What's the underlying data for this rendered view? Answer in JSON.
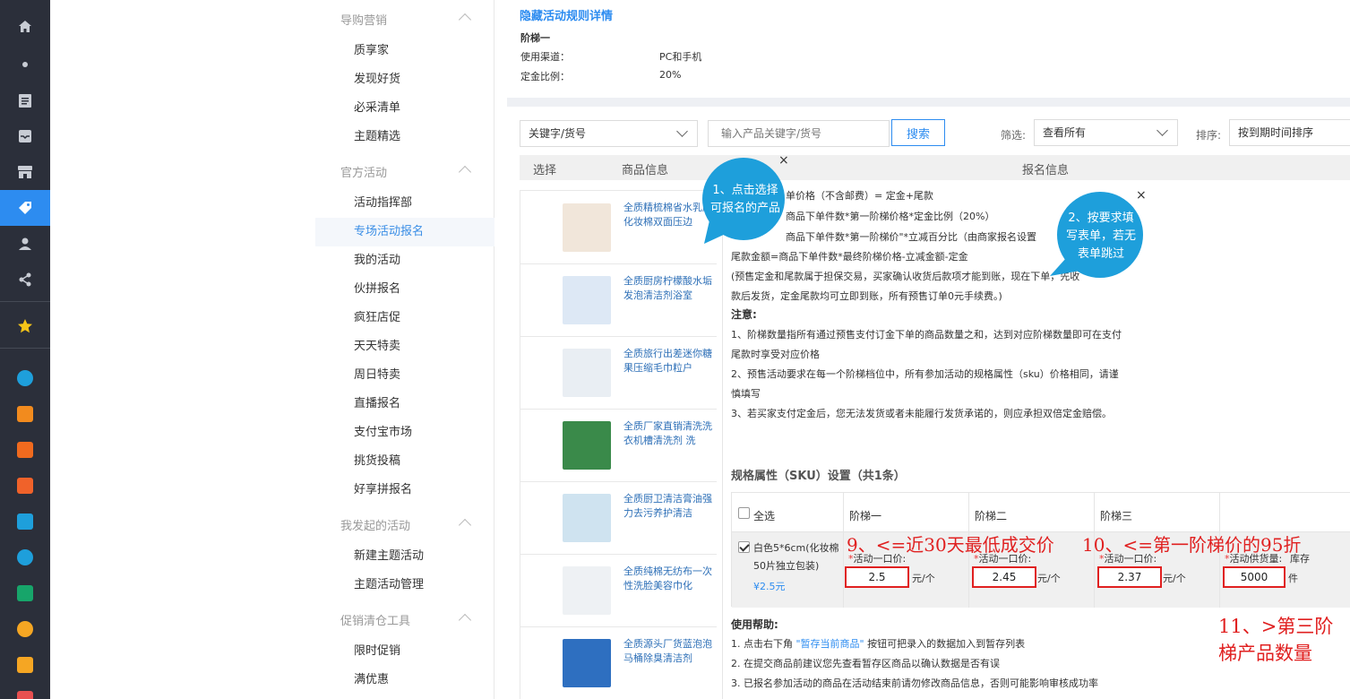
{
  "rail": {
    "icons": [
      "home-icon",
      "dot-icon",
      "clipboard-icon",
      "inbox-icon",
      "store-icon",
      "tag-icon",
      "user-icon",
      "share-icon",
      "star-icon",
      "app-icon-1",
      "app-icon-2",
      "app-icon-3",
      "app-icon-4",
      "app-icon-5",
      "app-icon-6",
      "app-icon-7",
      "app-icon-8",
      "app-icon-9",
      "app-icon-10"
    ],
    "app_colors": [
      "#1e9fdb",
      "#f28b1e",
      "#f06a1e",
      "#f0622a",
      "#1e9fdb",
      "#1e9fdb",
      "#17a56a",
      "#f5a623",
      "#f5a623",
      "#e85050"
    ]
  },
  "menu": {
    "sections": [
      {
        "label": "导购营销",
        "items": [
          "质享家",
          "发现好货",
          "必采清单",
          "主题精选"
        ]
      },
      {
        "label": "官方活动",
        "items": [
          "活动指挥部",
          "专场活动报名",
          "我的活动",
          "伙拼报名",
          "疯狂店促",
          "天天特卖",
          "周日特卖",
          "直播报名",
          "支付宝市场",
          "挑货投稿",
          "好享拼报名"
        ]
      },
      {
        "label": "我发起的活动",
        "items": [
          "新建主题活动",
          "主题活动管理"
        ]
      },
      {
        "label": "促销清仓工具",
        "items": [
          "限时促销",
          "满优惠"
        ]
      }
    ],
    "active_item": "专场活动报名"
  },
  "rules": {
    "title": "隐藏活动规则详情",
    "tier_title": "阶梯一",
    "channel_label": "使用渠道：",
    "channel_value": "PC和手机",
    "deposit_label": "定金比例：",
    "deposit_value": "20%"
  },
  "filters": {
    "keyword_select": "关键字/货号",
    "search_placeholder": "输入产品关键字/货号",
    "search_button": "搜索",
    "filter_label": "筛选:",
    "filter_value": "查看所有",
    "sort_label": "排序:",
    "sort_value": "按到期时间排序"
  },
  "table": {
    "headers": [
      "选择",
      "商品信息",
      "报名信息"
    ]
  },
  "products": [
    {
      "name": "全质精梳棉省水乳肤化妆棉双面压边",
      "img_color": "#f1e6da"
    },
    {
      "name": "全质厨房柠檬酸水垢发泡清洁剂浴室",
      "img_color": "#dde8f5"
    },
    {
      "name": "全质旅行出差迷你糖果压缩毛巾粒户",
      "img_color": "#e9eef3"
    },
    {
      "name": "全质厂家直销清洗洗衣机槽清洗剂 洗",
      "img_color": "#3a8a4a"
    },
    {
      "name": "全质厨卫清洁膏油强力去污养护清洁",
      "img_color": "#cfe3f0"
    },
    {
      "name": "全质纯棉无纺布一次性洗脸美容巾化",
      "img_color": "#eef1f4"
    },
    {
      "name": "全质源头厂货蓝泡泡马桶除臭清洁剂",
      "img_color": "#2e6fc0"
    }
  ],
  "modal": {
    "lines": [
      "单价格（不含邮费）= 定金+尾款",
      "商品下单件数*第一阶梯价格*定金比例（20%）",
      "商品下单件数*第一阶梯价\"*立减百分比（由商家报名设置",
      "尾款金额=商品下单件数*最终阶梯价格-立减金额-定金",
      "(预售定金和尾款属于担保交易，买家确认收货后款项才能到账，现在下单，先收",
      "款后发货，定金尾款均可立即到账，所有预售订单0元手续费。)"
    ],
    "notice_title": "注意:",
    "notices": [
      "1、阶梯数量指所有通过预售支付订金下单的商品数量之和，达到对应阶梯数量即可在支付",
      "尾款时享受对应价格",
      "2、预售活动要求在每一个阶梯档位中，所有参加活动的规格属性（sku）价格相同，请谨",
      "慎填写",
      "3、若买家支付定金后，您无法发货或者未能履行发货承诺的，则应承担双倍定金赔偿。"
    ],
    "sku_title": "规格属性（SKU）设置（共1条）",
    "select_all": "全选",
    "tiers": [
      "阶梯一",
      "阶梯二",
      "阶梯三"
    ],
    "sku_name": "白色5*6cm(化妆棉50片独立包装)",
    "sku_price": "¥2.5元",
    "price_label": "活动一口价:",
    "prices": [
      "2.5",
      "2.45",
      "2.37"
    ],
    "price_unit": "元/个",
    "supply_label": "活动供货量:",
    "stock_label": "库存",
    "supply_value": "5000",
    "supply_unit": "件",
    "help_title": "使用帮助:",
    "help": [
      {
        "pre": "1. 点击右下角 ",
        "hl": "\"暂存当前商品\"",
        "post": " 按钮可把录入的数据加入到暂存列表"
      },
      {
        "pre": "2. 在提交商品前建议您先查看暂存区商品以确认数据是否有误",
        "hl": "",
        "post": ""
      },
      {
        "pre": "3. 已报名参加活动的商品在活动结束前请勿修改商品信息，否则可能影响审核成功率",
        "hl": "",
        "post": ""
      }
    ]
  },
  "annotations": {
    "bubble1": "1、点击选择可报名的产品",
    "bubble2": "2、按要求填写表单，若无表单跳过",
    "note9": "9、<=近30天最低成交价",
    "note10": "10、<=第一阶梯价的95折",
    "note11_line1": "11、>第三阶",
    "note11_line2": "梯产品数量",
    "close": "×"
  }
}
